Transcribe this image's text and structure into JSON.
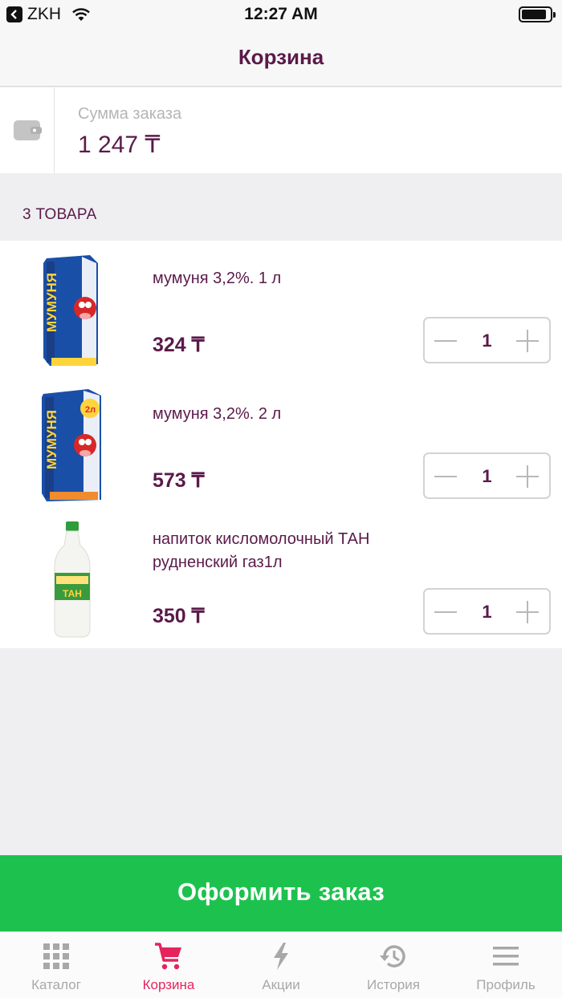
{
  "status_bar": {
    "carrier": "ZKH",
    "time": "12:27 AM"
  },
  "nav": {
    "title": "Корзина"
  },
  "summary": {
    "label": "Сумма заказа",
    "value": "1 247 ₸"
  },
  "items_count_label": "3 ТОВАРА",
  "items": [
    {
      "name": "мумуня 3,2%. 1 л",
      "price": "324 ₸",
      "quantity": "1",
      "image": "milk-carton-1l"
    },
    {
      "name": "мумуня 3,2%. 2 л",
      "price": "573 ₸",
      "quantity": "1",
      "image": "milk-carton-2l"
    },
    {
      "name": "напиток кисломолочный ТАН рудненский газ1л",
      "price": "350 ₸",
      "quantity": "1",
      "image": "tan-bottle"
    }
  ],
  "checkout": {
    "label": "Оформить заказ"
  },
  "tabs": [
    {
      "label": "Каталог",
      "icon": "grid-icon",
      "active": false
    },
    {
      "label": "Корзина",
      "icon": "cart-icon",
      "active": true
    },
    {
      "label": "Акции",
      "icon": "lightning-icon",
      "active": false
    },
    {
      "label": "История",
      "icon": "history-icon",
      "active": false
    },
    {
      "label": "Профиль",
      "icon": "menu-icon",
      "active": false
    }
  ],
  "colors": {
    "brand_text": "#5a1a4a",
    "checkout_green": "#1dc24e",
    "active_tab": "#e5245c",
    "inactive_tab": "#a8a8a8"
  }
}
